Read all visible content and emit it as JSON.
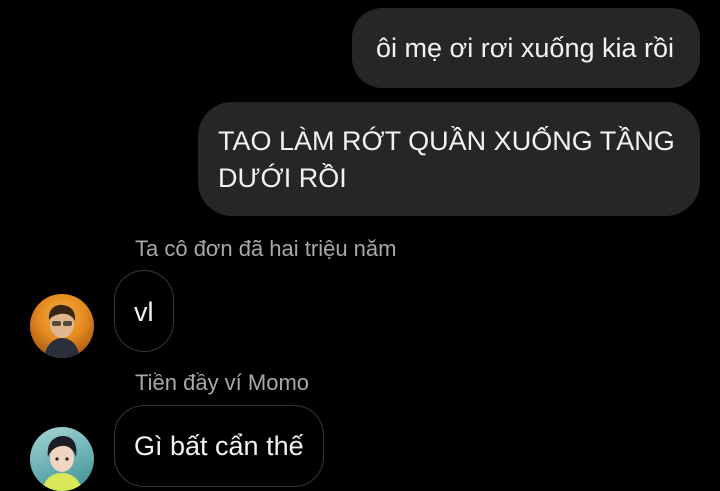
{
  "messages": {
    "outgoing": [
      {
        "text": "ôi mẹ ơi rơi xuống kia rồi"
      },
      {
        "text": "TAO LÀM RỚT QUẦN XUỐNG TẦNG DƯỚI RỒI"
      }
    ],
    "incoming": [
      {
        "sender": "Ta cô đơn đã hai triệu năm",
        "text": "vl"
      },
      {
        "sender": "Tiền đầy ví Momo",
        "text": "Gì bất cẩn thế"
      }
    ]
  },
  "colors": {
    "background": "#000000",
    "outgoing_bubble": "#262626",
    "incoming_border": "#363636",
    "sender_name": "#a8a8a8"
  },
  "icons": [
    "avatar-ta-co-don",
    "avatar-tien-day-vi"
  ]
}
